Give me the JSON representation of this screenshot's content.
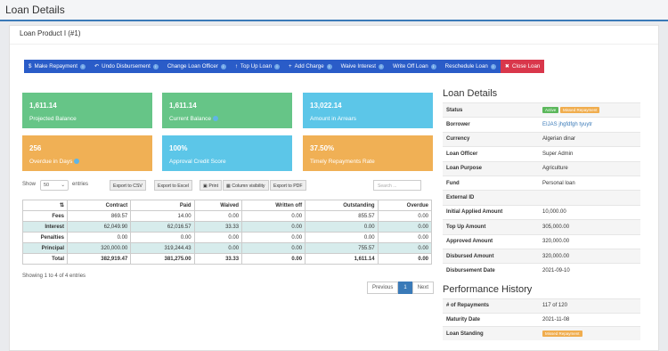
{
  "page": {
    "title": "Loan Details"
  },
  "card": {
    "title": "Loan Product I (#1)"
  },
  "actions": [
    {
      "label": "Make Repayment",
      "prefix": "$"
    },
    {
      "label": "Undo Disbursement",
      "prefix": "↶"
    },
    {
      "label": "Change Loan Officer",
      "prefix": ""
    },
    {
      "label": "Top Up Loan",
      "prefix": "↑"
    },
    {
      "label": "Add Charge",
      "prefix": "+"
    },
    {
      "label": "Waive Interest",
      "prefix": ""
    },
    {
      "label": "Write Off Loan",
      "prefix": ""
    },
    {
      "label": "Reschedule Loan",
      "prefix": ""
    },
    {
      "label": "Close Loan",
      "prefix": "✖"
    }
  ],
  "tiles": {
    "projected": {
      "value": "1,611.14",
      "label": "Projected Balance"
    },
    "current": {
      "value": "1,611.14",
      "label": "Current Balance"
    },
    "arrears": {
      "value": "13,022.14",
      "label": "Amount in Arrears"
    },
    "overdue": {
      "value": "256",
      "label": "Overdue in Days"
    },
    "approval": {
      "value": "100%",
      "label": "Approval Credit Score"
    },
    "timely": {
      "value": "37.50%",
      "label": "Timely Repayments Rate"
    }
  },
  "table_controls": {
    "show": "Show",
    "page_size": "50",
    "entries": "entries",
    "buttons": [
      "Export to CSV",
      "Export to Excel",
      "Print",
      "Column visibility",
      "Export to PDF"
    ],
    "search_placeholder": "Search ..."
  },
  "summary_table": {
    "headers": [
      "",
      "Contract",
      "Paid",
      "Waived",
      "Written off",
      "Outstanding",
      "Overdue"
    ],
    "rows": [
      [
        "Fees",
        "869.57",
        "14.00",
        "0.00",
        "0.00",
        "855.57",
        "0.00"
      ],
      [
        "Interest",
        "62,049.90",
        "62,016.57",
        "33.33",
        "0.00",
        "0.00",
        "0.00"
      ],
      [
        "Penalties",
        "0.00",
        "0.00",
        "0.00",
        "0.00",
        "0.00",
        "0.00"
      ],
      [
        "Principal",
        "320,000.00",
        "319,244.43",
        "0.00",
        "0.00",
        "755.57",
        "0.00"
      ],
      [
        "Total",
        "382,919.47",
        "381,275.00",
        "33.33",
        "0.00",
        "1,611.14",
        "0.00"
      ]
    ],
    "showing": "Showing 1 to 4 of 4 entries"
  },
  "pager": {
    "prev": "Previous",
    "page": "1",
    "next": "Next"
  },
  "loan_details": {
    "title": "Loan Details",
    "status_label": "Status",
    "status_badge_1": "Active",
    "status_badge_2": "Missed Repayment",
    "rows": [
      {
        "k": "Borrower",
        "v": "EIJAS jhgfdfgh tyuytr"
      },
      {
        "k": "Currency",
        "v": "Algerian dinar"
      },
      {
        "k": "Loan Officer",
        "v": "Super Admin"
      },
      {
        "k": "Loan Purpose",
        "v": "Agriculture"
      },
      {
        "k": "Fund",
        "v": "Personal loan"
      },
      {
        "k": "External ID",
        "v": ""
      },
      {
        "k": "Initial Applied Amount",
        "v": "10,000.00"
      },
      {
        "k": "Top Up Amount",
        "v": "305,000.00"
      },
      {
        "k": "Approved Amount",
        "v": "320,000.00"
      },
      {
        "k": "Disbursed Amount",
        "v": "320,000.00"
      },
      {
        "k": "Disbursement Date",
        "v": "2021-09-10"
      }
    ]
  },
  "performance": {
    "title": "Performance History",
    "repayments_label": "# of Repayments",
    "repayments_value": "117 of 120",
    "maturity_label": "Maturity Date",
    "maturity_value": "2021-11-08",
    "standing_label": "Loan Standing",
    "standing_badge": "Missed Repayment"
  },
  "colors": {
    "action_bar": "#2a5cc8",
    "close_btn": "#d9374b",
    "tile_green": "#66c587",
    "tile_blue": "#5cc6e8",
    "tile_orange": "#f0b055"
  }
}
